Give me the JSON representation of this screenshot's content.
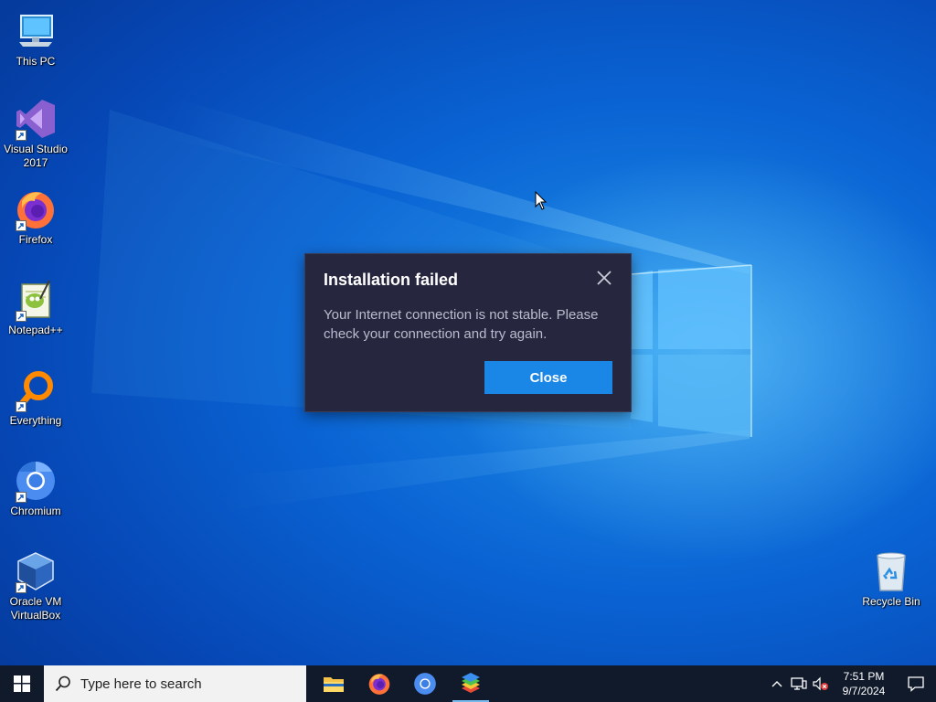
{
  "desktop": {
    "icons": [
      {
        "label": "This PC",
        "icon": "computer-icon"
      },
      {
        "label": "Visual Studio\n2017",
        "icon": "visual-studio-icon"
      },
      {
        "label": "Firefox",
        "icon": "firefox-icon"
      },
      {
        "label": "Notepad++",
        "icon": "notepad-plus-plus-icon"
      },
      {
        "label": "Everything",
        "icon": "everything-search-icon"
      },
      {
        "label": "Chromium",
        "icon": "chromium-icon"
      },
      {
        "label": "Oracle VM\nVirtualBox",
        "icon": "virtualbox-icon"
      }
    ],
    "recycle_bin": {
      "label": "Recycle Bin",
      "icon": "recycle-bin-icon"
    }
  },
  "dialog": {
    "title": "Installation failed",
    "message": "Your Internet connection is not stable. Please check your connection and try again.",
    "close_button": "Close",
    "colors": {
      "background": "#26273f",
      "accent": "#1a86e6"
    }
  },
  "taskbar": {
    "search_placeholder": "Type here to search",
    "apps": [
      {
        "name": "File Explorer",
        "icon": "folder-icon"
      },
      {
        "name": "Firefox",
        "icon": "firefox-icon"
      },
      {
        "name": "Chromium",
        "icon": "chromium-icon"
      },
      {
        "name": "BlueStacks",
        "icon": "bluestacks-icon",
        "active": true
      }
    ],
    "clock": {
      "time": "7:51 PM",
      "date": "9/7/2024"
    }
  }
}
